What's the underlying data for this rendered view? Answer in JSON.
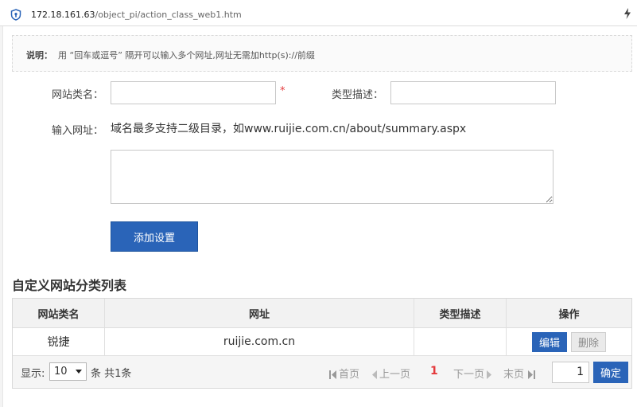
{
  "browser": {
    "url_host": "172.18.161.63",
    "url_path": "/object_pi/action_class_web1.htm"
  },
  "notice": {
    "label": "说明：",
    "text": "用 “回车或逗号” 隔开可以输入多个网址,网址无需加http(s)://前缀"
  },
  "form": {
    "name_label": "网站类名：",
    "name_value": "",
    "required_mark": "*",
    "desc_label": "类型描述：",
    "desc_value": "",
    "url_label": "输入网址：",
    "url_hint": "域名最多支持二级目录，如www.ruijie.com.cn/about/summary.aspx",
    "url_value": "",
    "add_button": "添加设置"
  },
  "list": {
    "title": "自定义网站分类列表",
    "columns": [
      "网站类名",
      "网址",
      "类型描述",
      "操作"
    ],
    "rows": [
      {
        "name": "锐捷",
        "url": "ruijie.com.cn",
        "desc": "",
        "edit": "编辑",
        "delete": "删除"
      }
    ]
  },
  "pager": {
    "show_label": "显示:",
    "page_size": "10",
    "total_text": "条 共1条",
    "first": "首页",
    "prev": "上一页",
    "current": "1",
    "next": "下一页",
    "last": "末页",
    "goto_value": "1",
    "confirm": "确定"
  },
  "colors": {
    "primary": "#2a64b8",
    "required": "#e4393c",
    "current_page": "#e4393c"
  }
}
